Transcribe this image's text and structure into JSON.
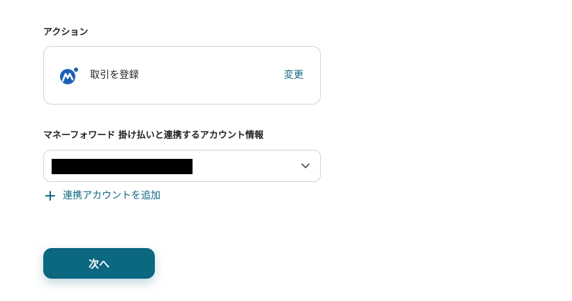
{
  "action_section": {
    "label": "アクション",
    "app_icon": "moneyforward-logo",
    "action_name": "取引を登録",
    "change_label": "変更"
  },
  "account_section": {
    "label": "マネーフォワード 掛け払いと連携するアカウント情報",
    "selected_value": "",
    "dropdown_icon": "chevron-down-icon",
    "add_icon": "plus-icon",
    "add_account_label": "連携アカウントを追加"
  },
  "footer": {
    "next_label": "次へ"
  },
  "colors": {
    "accent": "#0c6780",
    "logo_blue": "#1a5fb4",
    "border": "#cfd3d8"
  }
}
